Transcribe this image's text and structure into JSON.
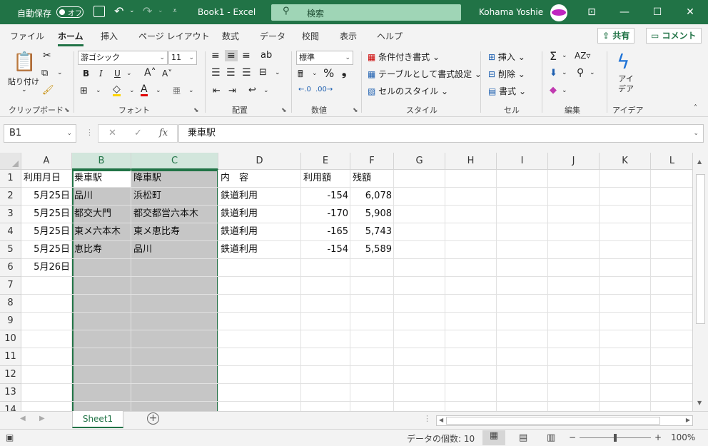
{
  "titlebar": {
    "autosave_label": "自動保存",
    "autosave_state": "オフ",
    "title": "Book1  -  Excel",
    "search_placeholder": "検索",
    "user_name": "Kohama Yoshie"
  },
  "menu": {
    "tabs": [
      "ファイル",
      "ホーム",
      "挿入",
      "ページ レイアウト",
      "数式",
      "データ",
      "校閲",
      "表示",
      "ヘルプ"
    ],
    "active_tab": "ホーム",
    "share_label": "共有",
    "comment_label": "コメント"
  },
  "ribbon": {
    "clipboard": {
      "paste_label": "貼り付け",
      "group": "クリップボード"
    },
    "font": {
      "font_name": "游ゴシック",
      "font_size": "11",
      "group": "フォント",
      "bold": "B",
      "italic": "I",
      "underline": "U"
    },
    "alignment": {
      "group": "配置"
    },
    "number": {
      "format": "標準",
      "percent": "%",
      "comma": "❟",
      "group": "数値"
    },
    "styles": {
      "conditional": "条件付き書式",
      "table": "テーブルとして書式設定",
      "cell_styles": "セルのスタイル",
      "group": "スタイル"
    },
    "cells": {
      "insert": "挿入",
      "delete": "削除",
      "format": "書式",
      "group": "セル"
    },
    "editing": {
      "group": "編集"
    },
    "ideas": {
      "label": "アイ\nデア",
      "group": "アイデア"
    }
  },
  "formula_bar": {
    "name_box": "B1",
    "formula": "乗車駅"
  },
  "columns": [
    "A",
    "B",
    "C",
    "D",
    "E",
    "F",
    "G",
    "H",
    "I",
    "J",
    "K",
    "L"
  ],
  "selected_columns": [
    "B",
    "C"
  ],
  "rows": [
    "1",
    "2",
    "3",
    "4",
    "5",
    "6",
    "7",
    "8",
    "9",
    "10",
    "11",
    "12",
    "13",
    "14"
  ],
  "cells": {
    "A1": "利用月日",
    "B1": "乗車駅",
    "C1": "降車駅",
    "D1": "内　容",
    "E1": "利用額",
    "F1": "残額",
    "A2": "5月25日",
    "B2": "品川",
    "C2": "浜松町",
    "D2": "鉄道利用",
    "E2": "-154",
    "F2": "6,078",
    "A3": "5月25日",
    "B3": "都交大門",
    "C3": "都交都営六本木",
    "D3": "鉄道利用",
    "E3": "-170",
    "F3": "5,908",
    "A4": "5月25日",
    "B4": "東メ六本木",
    "C4": "東メ恵比寿",
    "D4": "鉄道利用",
    "E4": "-165",
    "F4": "5,743",
    "A5": "5月25日",
    "B5": "恵比寿",
    "C5": "品川",
    "D5": "鉄道利用",
    "E5": "-154",
    "F5": "5,589",
    "A6": "5月26日"
  },
  "sheets": {
    "active": "Sheet1"
  },
  "status": {
    "count": "データの個数: 10",
    "zoom": "100%"
  },
  "colors": {
    "accent": "#217346",
    "selection": "#c6c6c6",
    "title_bg": "#217346"
  }
}
